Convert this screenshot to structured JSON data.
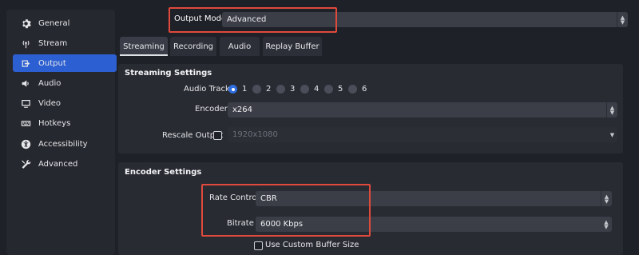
{
  "sidebar": {
    "items": [
      {
        "label": "General",
        "icon": "gear-icon"
      },
      {
        "label": "Stream",
        "icon": "antenna-icon"
      },
      {
        "label": "Output",
        "icon": "output-icon"
      },
      {
        "label": "Audio",
        "icon": "speaker-icon"
      },
      {
        "label": "Video",
        "icon": "monitor-icon"
      },
      {
        "label": "Hotkeys",
        "icon": "keyboard-icon"
      },
      {
        "label": "Accessibility",
        "icon": "accessibility-icon"
      },
      {
        "label": "Advanced",
        "icon": "tools-icon"
      }
    ],
    "active": "Output"
  },
  "output_mode": {
    "label": "Output Mode",
    "value": "Advanced"
  },
  "tabs": [
    {
      "label": "Streaming"
    },
    {
      "label": "Recording"
    },
    {
      "label": "Audio"
    },
    {
      "label": "Replay Buffer"
    }
  ],
  "streaming_settings": {
    "title": "Streaming Settings",
    "audio_track_label": "Audio Track",
    "tracks": [
      "1",
      "2",
      "3",
      "4",
      "5",
      "6"
    ],
    "selected_track": "1",
    "encoder_label": "Encoder",
    "encoder_value": "x264",
    "rescale_label": "Rescale Output",
    "rescale_value": "1920x1080"
  },
  "encoder_settings": {
    "title": "Encoder Settings",
    "rate_control_label": "Rate Control",
    "rate_control_value": "CBR",
    "bitrate_label": "Bitrate",
    "bitrate_value": "6000 Kbps",
    "custom_buffer_label": "Use Custom Buffer Size"
  },
  "colors": {
    "accent": "#2c5fd2",
    "highlight": "#e04a3c",
    "background": "#1f2128"
  }
}
